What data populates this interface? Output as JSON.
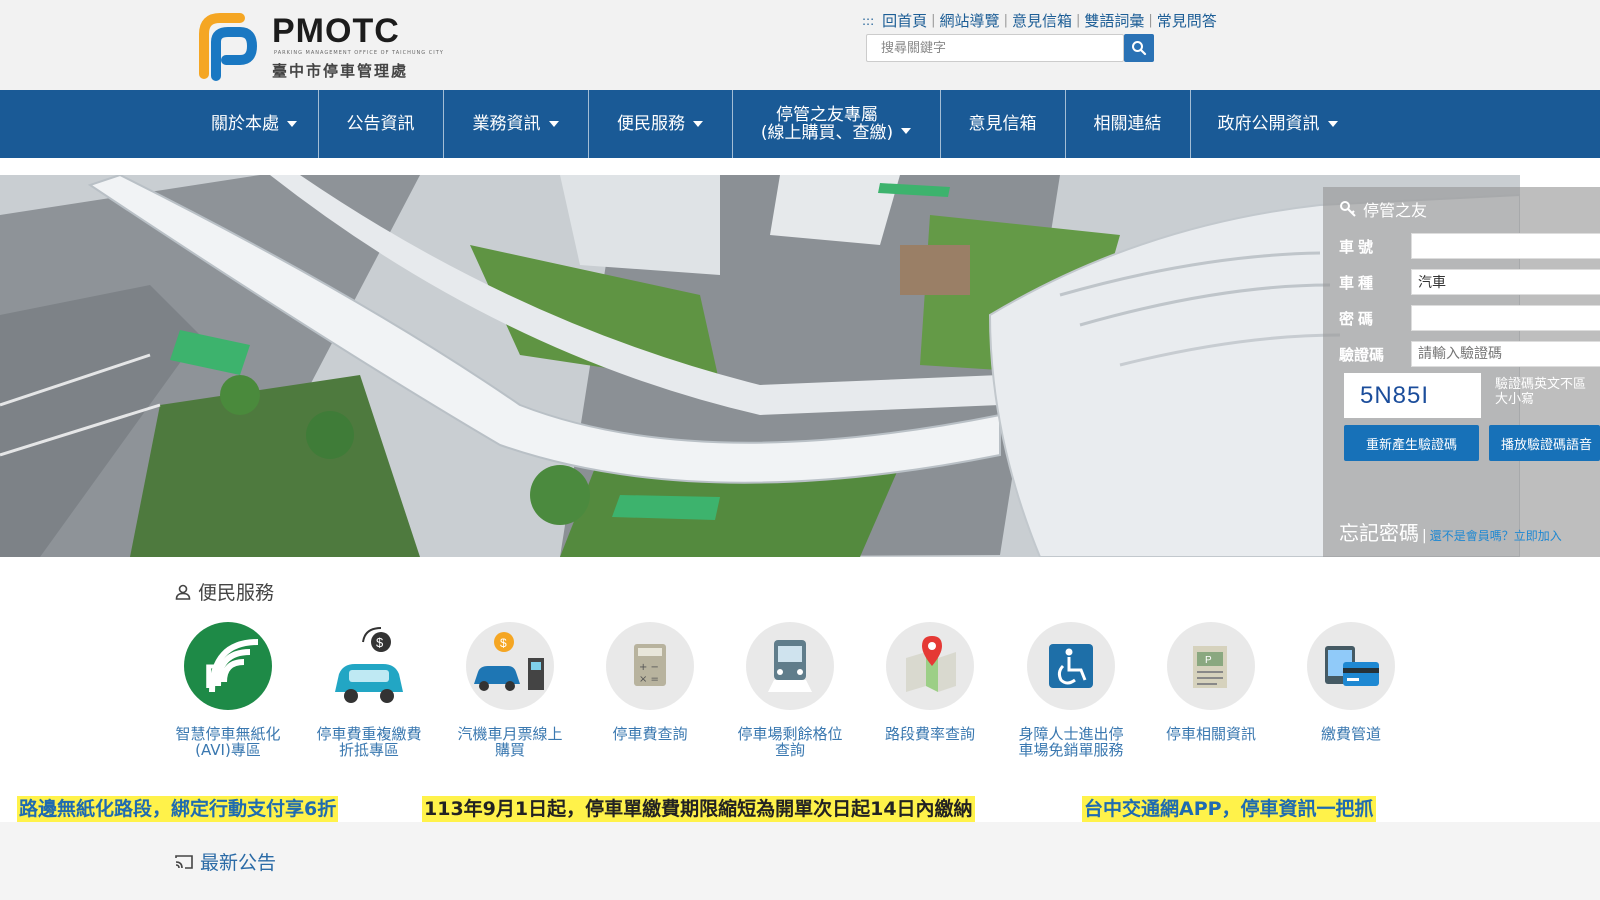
{
  "logo": {
    "title": "PMOTC",
    "subtitle_en": "PARKING MANAGEMENT OFFICE OF TAICHUNG CITY",
    "subtitle_zh": "臺中市停車管理處"
  },
  "top_links": [
    "回首頁",
    "網站導覽",
    "意見信箱",
    "雙語詞彙",
    "常見問答"
  ],
  "top_links_marker": ":::",
  "search": {
    "placeholder": "搜尋關鍵字"
  },
  "nav": {
    "items": [
      {
        "label": "關於本處",
        "dropdown": true
      },
      {
        "label": "公告資訊",
        "dropdown": false
      },
      {
        "label": "業務資訊",
        "dropdown": true
      },
      {
        "label": "便民服務",
        "dropdown": true
      },
      {
        "label": "停管之友專屬",
        "label2": "(線上購買、查繳)",
        "dropdown": true
      },
      {
        "label": "意見信箱",
        "dropdown": false
      },
      {
        "label": "相關連結",
        "dropdown": false
      },
      {
        "label": "政府公開資訊",
        "dropdown": true
      }
    ]
  },
  "login": {
    "title": "停管之友",
    "plate_label": "車號",
    "plate_value": "",
    "type_label": "車種",
    "type_value": "汽車",
    "password_label": "密碼",
    "password_value": "",
    "captcha_label": "驗證碼",
    "captcha_placeholder": "請輸入驗證碼",
    "captcha_code": "5N85I",
    "captcha_note_1": "驗證碼英文不區",
    "captcha_note_2": "大小寫",
    "regen_button": "重新產生驗證碼",
    "audio_button": "播放驗證碼語音",
    "forgot_label": "忘記密碼",
    "separator": "|",
    "register_label": "還不是會員嗎？立即加入"
  },
  "services_section": {
    "title": "便民服務"
  },
  "services": [
    {
      "label": "智慧停車無紙化(AVI)專區",
      "icon": "avi-parking-icon"
    },
    {
      "label": "停車費重複繳費折抵專區",
      "icon": "car-refund-icon"
    },
    {
      "label": "汽機車月票線上購買",
      "icon": "monthly-pass-icon"
    },
    {
      "label": "停車費查詢",
      "icon": "calculator-icon"
    },
    {
      "label": "停車場剩餘格位查詢",
      "icon": "bus-parking-icon"
    },
    {
      "label": "路段費率查詢",
      "icon": "map-pin-icon"
    },
    {
      "label": "身障人士進出停車場免銷單服務",
      "icon": "wheelchair-icon"
    },
    {
      "label": "停車相關資訊",
      "icon": "newspaper-icon"
    },
    {
      "label": "繳費管道",
      "icon": "payment-card-icon"
    }
  ],
  "marquee": [
    {
      "text": "路邊無紙化路段，綁定行動支付享6折",
      "bg": "#fff24a",
      "color": "#1f6bb0"
    },
    {
      "text": "113年9月1日起，停車單繳費期限縮短為開單次日起14日內繳納",
      "bg": "#fff24a",
      "color": "#222222"
    },
    {
      "text": "台中交通網APP，停車資訊一把抓",
      "bg": "#fff24a",
      "color": "#1f6bb0"
    }
  ],
  "news_section": {
    "title": "最新公告"
  },
  "colors": {
    "nav_bg": "#1a5a96",
    "accent": "#1771b8",
    "link": "#1d5e96"
  }
}
